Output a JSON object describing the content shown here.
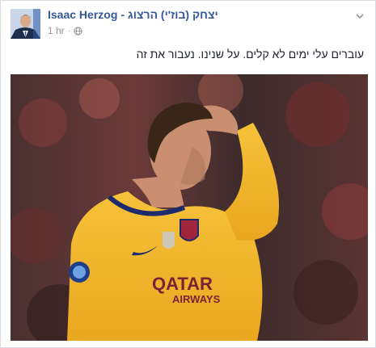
{
  "post": {
    "author_en": "Isaac Herzog",
    "separator": "-",
    "author_he": "יצחק (בוז'י) הרצוג",
    "time": "1 hr",
    "dot": "·",
    "privacy_icon": "globe-icon",
    "menu_icon": "chevron-down-icon",
    "text": "עוברים עלי ימים לא קלים. על שנינו. נעבור את זה"
  },
  "photo": {
    "jersey_sponsor_line1": "QATAR",
    "jersey_sponsor_line2": "AIRWAYS"
  },
  "colors": {
    "link": "#365899",
    "meta": "#90949c",
    "jersey": "#f2b92e",
    "jersey_trim": "#1d2a6b"
  }
}
